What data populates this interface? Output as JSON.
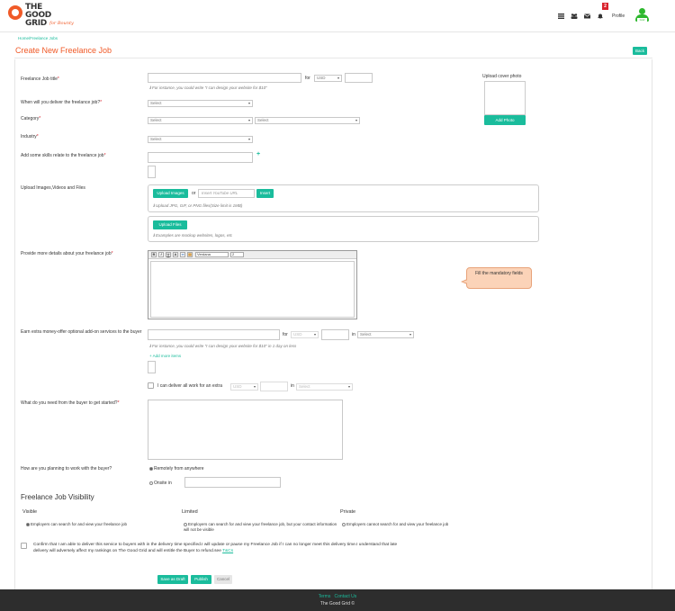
{
  "header": {
    "logo_title": "THE GOOD GRID",
    "logo_subtitle": "for Bounty",
    "notifications_count": "2",
    "profile_label": "Profile",
    "avatar_tag": "Grid",
    "icons": [
      "grid-icon",
      "users-icon",
      "mail-icon",
      "bell-icon"
    ]
  },
  "breadcrumb": "Home/Freelance Jobs",
  "page_title": "Create New Freelance Job",
  "back_label": "Back",
  "form": {
    "title_label": "Freelance Job title",
    "title_for": "for",
    "currency": "USD",
    "title_hint": "For instance, you could write \"I can design your website for $10\"",
    "cover_label": "Upload cover photo",
    "add_photo": "Add Photo",
    "delivery_label": "When will you deliver the freelance job?",
    "select_placeholder": "Select",
    "category_label": "Category",
    "industry_label": "Industry",
    "skills_label": "Add some skills relate to the freelance job",
    "upload_label": "Upload Images,Videos and Files",
    "upload_images": "Upload Images",
    "or": "or",
    "youtube_placeholder": "Insert YouTube URL",
    "insert": "Insert",
    "upload_hint": "Upload JPG, GIF, or PNG files(Size limit is 1MB)",
    "upload_files": "Upload Files",
    "files_hint": "Examples are mockup websites, logos, etc",
    "details_label": "Provide more details about your freelance job",
    "editor_font": "Verdana",
    "editor_size": "2",
    "callout": "Fill the mandatory fields",
    "addon_label": "Earn extra money-offer optional add-on services to the buyer",
    "addon_for": "for",
    "addon_in": "in",
    "addon_hint": "For instance, you could write \"I can design your website for $10\" in 1 day on less",
    "add_more": "+ Add more items",
    "extra_label": "I can deliver all work for an extra",
    "extra_in": "in",
    "buyer_label": "What do you need from the buyer to get started?",
    "work_label": "How are you planning to work with the buyer?",
    "work_remote": "Remotely from anywhere",
    "work_onsite": "Onsite in"
  },
  "visibility": {
    "heading": "Freelance Job Visibility",
    "visible_title": "Visible",
    "visible_text": "Employers can search for and view your freelance job",
    "limited_title": "Limited",
    "limited_text": "Employers can search for and view your freelance job, but your contact information will not be visible",
    "private_title": "Private",
    "private_text": "Employers cannot search for and view your freelance job"
  },
  "confirm": {
    "text": "Confirm that I am able to deliver this service to buyers with in the delivery time specified.I will update or pause my Freelance Job if I can no longer meet this delivery time.I understand that late delivery will adversely affect my rankings on The Good Grid and will entitle the Buyer to refund.see",
    "link": "T&Cs"
  },
  "actions": {
    "save_draft": "Save as Draft",
    "publish": "Publish",
    "cancel": "Cancel"
  },
  "footer": {
    "terms": "Terms",
    "contact": "Contact Us",
    "copyright": "The Good Grid ©"
  },
  "colors": {
    "accent": "#1abc9c",
    "brand": "#f05a28",
    "required": "#d9232d"
  }
}
